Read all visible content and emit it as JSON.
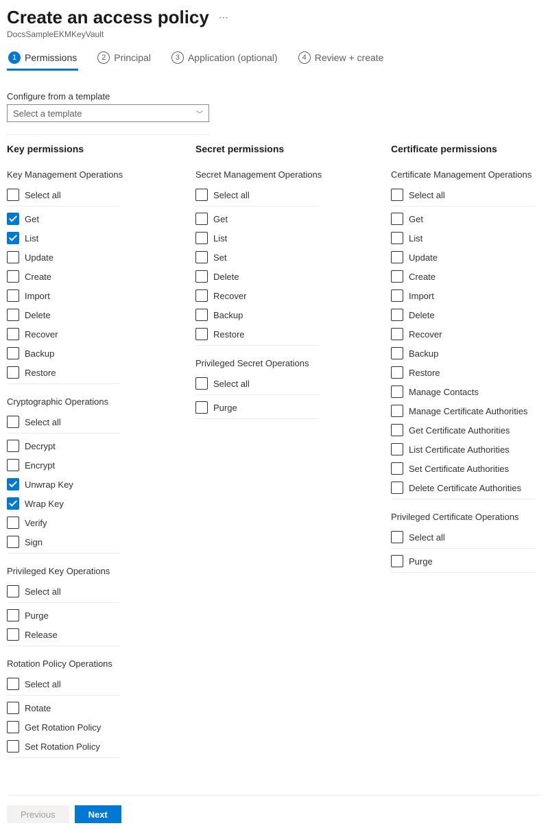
{
  "header": {
    "title": "Create an access policy",
    "subtitle": "DocsSampleEKMKeyVault"
  },
  "tabs": [
    {
      "num": "1",
      "label": "Permissions",
      "active": true
    },
    {
      "num": "2",
      "label": "Principal",
      "active": false
    },
    {
      "num": "3",
      "label": "Application (optional)",
      "active": false
    },
    {
      "num": "4",
      "label": "Review + create",
      "active": false
    }
  ],
  "template": {
    "label": "Configure from a template",
    "placeholder": "Select a template"
  },
  "columns": [
    {
      "title": "Key permissions",
      "groups": [
        {
          "title": "Key Management Operations",
          "select_all": "Select all",
          "items": [
            {
              "label": "Get",
              "checked": true
            },
            {
              "label": "List",
              "checked": true
            },
            {
              "label": "Update",
              "checked": false
            },
            {
              "label": "Create",
              "checked": false
            },
            {
              "label": "Import",
              "checked": false
            },
            {
              "label": "Delete",
              "checked": false
            },
            {
              "label": "Recover",
              "checked": false
            },
            {
              "label": "Backup",
              "checked": false
            },
            {
              "label": "Restore",
              "checked": false
            }
          ]
        },
        {
          "title": "Cryptographic Operations",
          "select_all": "Select all",
          "items": [
            {
              "label": "Decrypt",
              "checked": false
            },
            {
              "label": "Encrypt",
              "checked": false
            },
            {
              "label": "Unwrap Key",
              "checked": true
            },
            {
              "label": "Wrap Key",
              "checked": true
            },
            {
              "label": "Verify",
              "checked": false
            },
            {
              "label": "Sign",
              "checked": false
            }
          ]
        },
        {
          "title": "Privileged Key Operations",
          "select_all": "Select all",
          "items": [
            {
              "label": "Purge",
              "checked": false
            },
            {
              "label": "Release",
              "checked": false
            }
          ]
        },
        {
          "title": "Rotation Policy Operations",
          "select_all": "Select all",
          "items": [
            {
              "label": "Rotate",
              "checked": false
            },
            {
              "label": "Get Rotation Policy",
              "checked": false
            },
            {
              "label": "Set Rotation Policy",
              "checked": false
            }
          ]
        }
      ]
    },
    {
      "title": "Secret permissions",
      "groups": [
        {
          "title": "Secret Management Operations",
          "select_all": "Select all",
          "items": [
            {
              "label": "Get",
              "checked": false
            },
            {
              "label": "List",
              "checked": false
            },
            {
              "label": "Set",
              "checked": false
            },
            {
              "label": "Delete",
              "checked": false
            },
            {
              "label": "Recover",
              "checked": false
            },
            {
              "label": "Backup",
              "checked": false
            },
            {
              "label": "Restore",
              "checked": false
            }
          ]
        },
        {
          "title": "Privileged Secret Operations",
          "select_all": "Select all",
          "items": [
            {
              "label": "Purge",
              "checked": false
            }
          ]
        }
      ]
    },
    {
      "title": "Certificate permissions",
      "groups": [
        {
          "title": "Certificate Management Operations",
          "select_all": "Select all",
          "items": [
            {
              "label": "Get",
              "checked": false
            },
            {
              "label": "List",
              "checked": false
            },
            {
              "label": "Update",
              "checked": false
            },
            {
              "label": "Create",
              "checked": false
            },
            {
              "label": "Import",
              "checked": false
            },
            {
              "label": "Delete",
              "checked": false
            },
            {
              "label": "Recover",
              "checked": false
            },
            {
              "label": "Backup",
              "checked": false
            },
            {
              "label": "Restore",
              "checked": false
            },
            {
              "label": "Manage Contacts",
              "checked": false
            },
            {
              "label": "Manage Certificate Authorities",
              "checked": false
            },
            {
              "label": "Get Certificate Authorities",
              "checked": false
            },
            {
              "label": "List Certificate Authorities",
              "checked": false
            },
            {
              "label": "Set Certificate Authorities",
              "checked": false
            },
            {
              "label": "Delete Certificate Authorities",
              "checked": false
            }
          ]
        },
        {
          "title": "Privileged Certificate Operations",
          "select_all": "Select all",
          "items": [
            {
              "label": "Purge",
              "checked": false
            }
          ]
        }
      ]
    }
  ],
  "footer": {
    "previous": "Previous",
    "next": "Next"
  }
}
